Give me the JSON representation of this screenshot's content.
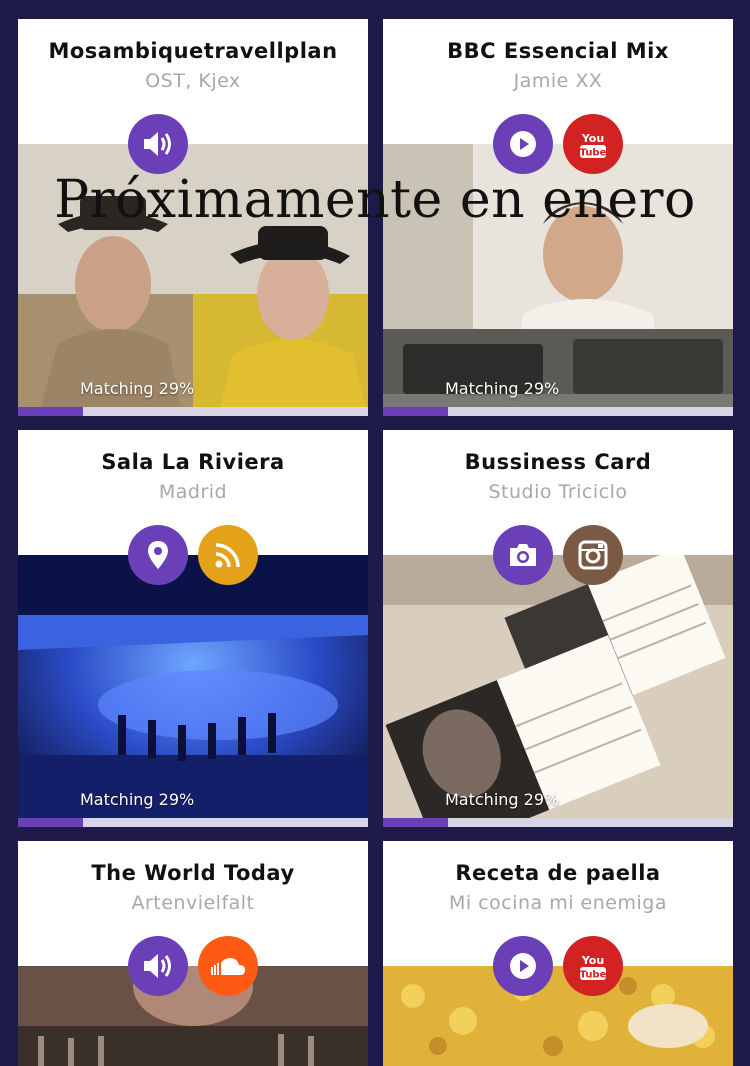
{
  "overlay": "Próximamente en enero",
  "colors": {
    "background": "#1e1b4a",
    "accent": "#6a3fb8",
    "youtube": "#d32222",
    "rss": "#e3a21a",
    "instagram": "#7a5a45",
    "soundcloud": "#ff5a13"
  },
  "cards": [
    {
      "title": "Mosambiquetravellplan",
      "subtitle": "OST, Kjex",
      "icons": [
        "speaker-icon"
      ],
      "matching": "Matching 29%",
      "progress": 0.185
    },
    {
      "title": "BBC Essencial Mix",
      "subtitle": "Jamie XX",
      "icons": [
        "play-icon",
        "youtube-icon"
      ],
      "matching": "Matching 29%",
      "progress": 0.185
    },
    {
      "title": "Sala La Riviera",
      "subtitle": "Madrid",
      "icons": [
        "location-pin-icon",
        "rss-icon"
      ],
      "matching": "Matching 29%",
      "progress": 0.185
    },
    {
      "title": "Bussiness Card",
      "subtitle": "Studio Triciclo",
      "icons": [
        "camera-icon",
        "instagram-icon"
      ],
      "matching": "Matching 29%",
      "progress": 0.185
    },
    {
      "title": "The World Today",
      "subtitle": "Artenvielfalt",
      "icons": [
        "speaker-icon",
        "soundcloud-icon"
      ]
    },
    {
      "title": "Receta de paella",
      "subtitle": "Mi cocina mi enemiga",
      "icons": [
        "play-icon",
        "youtube-icon"
      ]
    }
  ]
}
